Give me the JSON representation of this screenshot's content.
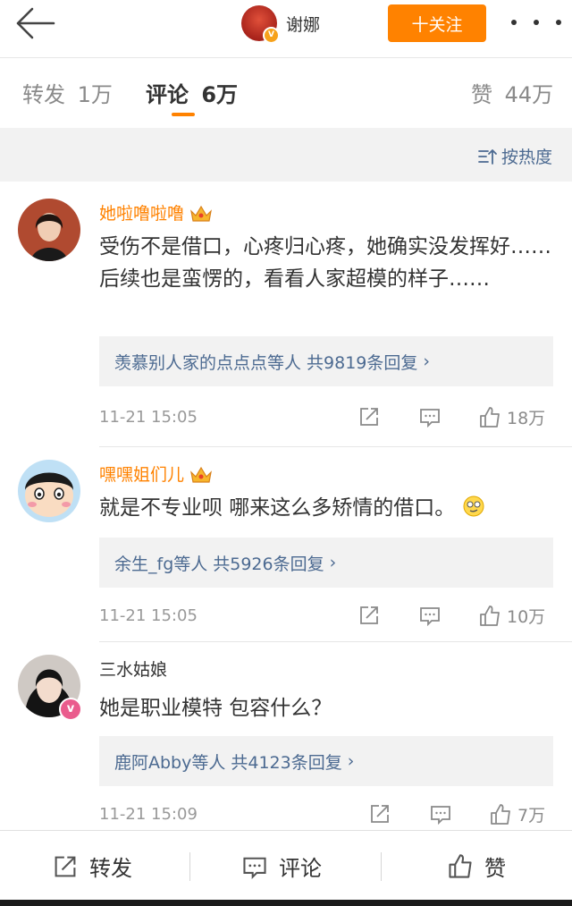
{
  "header": {
    "author_name": "谢娜",
    "follow_label": "十关注"
  },
  "tabs": [
    {
      "label": "转发",
      "count": "1万"
    },
    {
      "label": "评论",
      "count": "6万"
    },
    {
      "label": "赞",
      "count": "44万"
    }
  ],
  "sort_label": "按热度",
  "comments": [
    {
      "name": "她啦噜啦噜",
      "text": "受伤不是借口，心疼归心疼，她确实没发挥好……后续也是蛮愣的，看看人家超模的样子……",
      "replies_by": "羡慕别人家的点点点等人",
      "reply_count": "共9819条回复",
      "time": "11-21 15:05",
      "likes": "18万"
    },
    {
      "name": "嘿嘿姐们儿",
      "text": "就是不专业呗 哪来这么多矫情的借口。",
      "replies_by": "余生_fg等人",
      "reply_count": "共5926条回复",
      "time": "11-21 15:05",
      "likes": "10万"
    },
    {
      "name": "三水姑娘",
      "text": "她是职业模特  包容什么？",
      "replies_by": "鹿阿Abby等人",
      "reply_count": "共4123条回复",
      "time": "11-21 15:09",
      "likes": "7万"
    }
  ],
  "bottom_bar": {
    "repost": "转发",
    "comment": "评论",
    "like": "赞"
  },
  "colors": {
    "accent": "#ff8200",
    "link": "#4c6a91",
    "muted": "#999999"
  }
}
